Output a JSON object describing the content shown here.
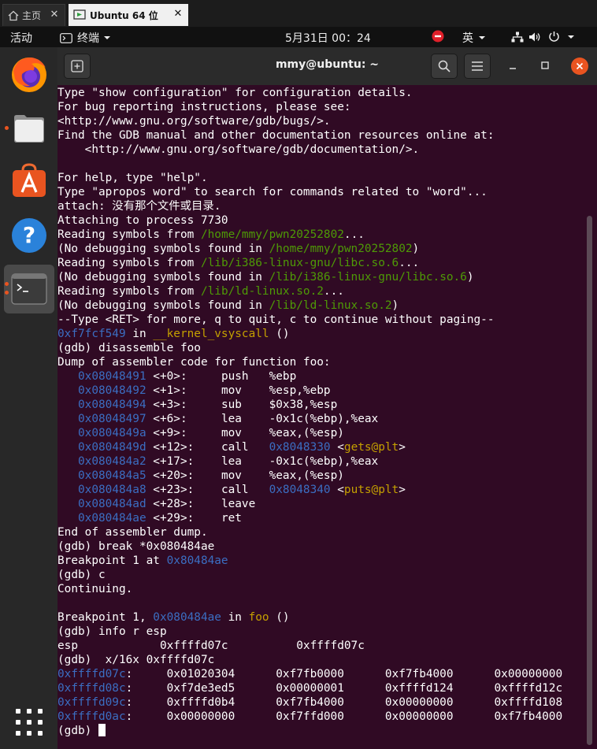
{
  "vmtabs": {
    "home_label": "主页",
    "vm_label": "Ubuntu 64 位",
    "close_glyph": "✕"
  },
  "topbar": {
    "activities": "活动",
    "app_menu": "终端",
    "clock": "5月31日  00：24",
    "input_method": "英"
  },
  "dock": {
    "items": [
      "firefox",
      "files",
      "software-center",
      "help",
      "terminal",
      "show-applications"
    ]
  },
  "terminal": {
    "title": "mmy@ubuntu: ~",
    "lines": [
      [
        {
          "t": "Type \"show configuration\" for configuration details."
        }
      ],
      [
        {
          "t": "For bug reporting instructions, please see:"
        }
      ],
      [
        {
          "t": "<http://www.gnu.org/software/gdb/bugs/>."
        }
      ],
      [
        {
          "t": "Find the GDB manual and other documentation resources online at:"
        }
      ],
      [
        {
          "t": "    <http://www.gnu.org/software/gdb/documentation/>."
        }
      ],
      [
        {
          "t": ""
        }
      ],
      [
        {
          "t": "For help, type \"help\"."
        }
      ],
      [
        {
          "t": "Type \"apropos word\" to search for commands related to \"word\"..."
        }
      ],
      [
        {
          "t": "attach: 没有那个文件或目录."
        }
      ],
      [
        {
          "t": "Attaching to process 7730"
        }
      ],
      [
        {
          "t": "Reading symbols from "
        },
        {
          "t": "/home/mmy/pwn20252802",
          "c": "green"
        },
        {
          "t": "..."
        }
      ],
      [
        {
          "t": "(No debugging symbols found in "
        },
        {
          "t": "/home/mmy/pwn20252802",
          "c": "green"
        },
        {
          "t": ")"
        }
      ],
      [
        {
          "t": "Reading symbols from "
        },
        {
          "t": "/lib/i386-linux-gnu/libc.so.6",
          "c": "green"
        },
        {
          "t": "..."
        }
      ],
      [
        {
          "t": "(No debugging symbols found in "
        },
        {
          "t": "/lib/i386-linux-gnu/libc.so.6",
          "c": "green"
        },
        {
          "t": ")"
        }
      ],
      [
        {
          "t": "Reading symbols from "
        },
        {
          "t": "/lib/ld-linux.so.2",
          "c": "green"
        },
        {
          "t": "..."
        }
      ],
      [
        {
          "t": "(No debugging symbols found in "
        },
        {
          "t": "/lib/ld-linux.so.2",
          "c": "green"
        },
        {
          "t": ")"
        }
      ],
      [
        {
          "t": "--Type <RET> for more, q to quit, c to continue without paging--"
        }
      ],
      [
        {
          "t": "0xf7fcf549",
          "c": "blue"
        },
        {
          "t": " in "
        },
        {
          "t": "__kernel_vsyscall",
          "c": "yellow"
        },
        {
          "t": " ()"
        }
      ],
      [
        {
          "t": "(gdb) disassemble foo"
        }
      ],
      [
        {
          "t": "Dump of assembler code for function foo:"
        }
      ],
      [
        {
          "t": "   "
        },
        {
          "t": "0x08048491",
          "c": "blue"
        },
        {
          "t": " <+0>:     push   %ebp"
        }
      ],
      [
        {
          "t": "   "
        },
        {
          "t": "0x08048492",
          "c": "blue"
        },
        {
          "t": " <+1>:     mov    %esp,%ebp"
        }
      ],
      [
        {
          "t": "   "
        },
        {
          "t": "0x08048494",
          "c": "blue"
        },
        {
          "t": " <+3>:     sub    $0x38,%esp"
        }
      ],
      [
        {
          "t": "   "
        },
        {
          "t": "0x08048497",
          "c": "blue"
        },
        {
          "t": " <+6>:     lea    -0x1c(%ebp),%eax"
        }
      ],
      [
        {
          "t": "   "
        },
        {
          "t": "0x0804849a",
          "c": "blue"
        },
        {
          "t": " <+9>:     mov    %eax,(%esp)"
        }
      ],
      [
        {
          "t": "   "
        },
        {
          "t": "0x0804849d",
          "c": "blue"
        },
        {
          "t": " <+12>:    call   "
        },
        {
          "t": "0x8048330",
          "c": "blue"
        },
        {
          "t": " <"
        },
        {
          "t": "gets@plt",
          "c": "yellow"
        },
        {
          "t": ">"
        }
      ],
      [
        {
          "t": "   "
        },
        {
          "t": "0x080484a2",
          "c": "blue"
        },
        {
          "t": " <+17>:    lea    -0x1c(%ebp),%eax"
        }
      ],
      [
        {
          "t": "   "
        },
        {
          "t": "0x080484a5",
          "c": "blue"
        },
        {
          "t": " <+20>:    mov    %eax,(%esp)"
        }
      ],
      [
        {
          "t": "   "
        },
        {
          "t": "0x080484a8",
          "c": "blue"
        },
        {
          "t": " <+23>:    call   "
        },
        {
          "t": "0x8048340",
          "c": "blue"
        },
        {
          "t": " <"
        },
        {
          "t": "puts@plt",
          "c": "yellow"
        },
        {
          "t": ">"
        }
      ],
      [
        {
          "t": "   "
        },
        {
          "t": "0x080484ad",
          "c": "blue"
        },
        {
          "t": " <+28>:    leave"
        }
      ],
      [
        {
          "t": "   "
        },
        {
          "t": "0x080484ae",
          "c": "blue"
        },
        {
          "t": " <+29>:    ret"
        }
      ],
      [
        {
          "t": "End of assembler dump."
        }
      ],
      [
        {
          "t": "(gdb) break *0x080484ae"
        }
      ],
      [
        {
          "t": "Breakpoint 1 at "
        },
        {
          "t": "0x80484ae",
          "c": "blue"
        }
      ],
      [
        {
          "t": "(gdb) c"
        }
      ],
      [
        {
          "t": "Continuing."
        }
      ],
      [
        {
          "t": ""
        }
      ],
      [
        {
          "t": "Breakpoint 1, "
        },
        {
          "t": "0x080484ae",
          "c": "blue"
        },
        {
          "t": " in "
        },
        {
          "t": "foo",
          "c": "yellow"
        },
        {
          "t": " ()"
        }
      ],
      [
        {
          "t": "(gdb) info r esp"
        }
      ],
      [
        {
          "t": "esp            0xffffd07c          0xffffd07c"
        }
      ],
      [
        {
          "t": "(gdb)  x/16x 0xffffd07c"
        }
      ],
      [
        {
          "t": "0xffffd07c",
          "c": "blue"
        },
        {
          "t": ":     0x01020304      0xf7fb0000      0xf7fb4000      0x00000000"
        }
      ],
      [
        {
          "t": "0xffffd08c",
          "c": "blue"
        },
        {
          "t": ":     0xf7de3ed5      0x00000001      0xffffd124      0xffffd12c"
        }
      ],
      [
        {
          "t": "0xffffd09c",
          "c": "blue"
        },
        {
          "t": ":     0xffffd0b4      0xf7fb4000      0x00000000      0xffffd108"
        }
      ],
      [
        {
          "t": "0xffffd0ac",
          "c": "blue"
        },
        {
          "t": ":     0x00000000      0xf7ffd000      0x00000000      0xf7fb4000"
        }
      ]
    ],
    "prompt": "(gdb) "
  },
  "colors": {
    "terminal_bg": "#300a24",
    "address_blue": "#3b6ec2",
    "path_green": "#4e9a06",
    "symbol_yellow": "#c4a000",
    "ubuntu_orange": "#e95420"
  }
}
